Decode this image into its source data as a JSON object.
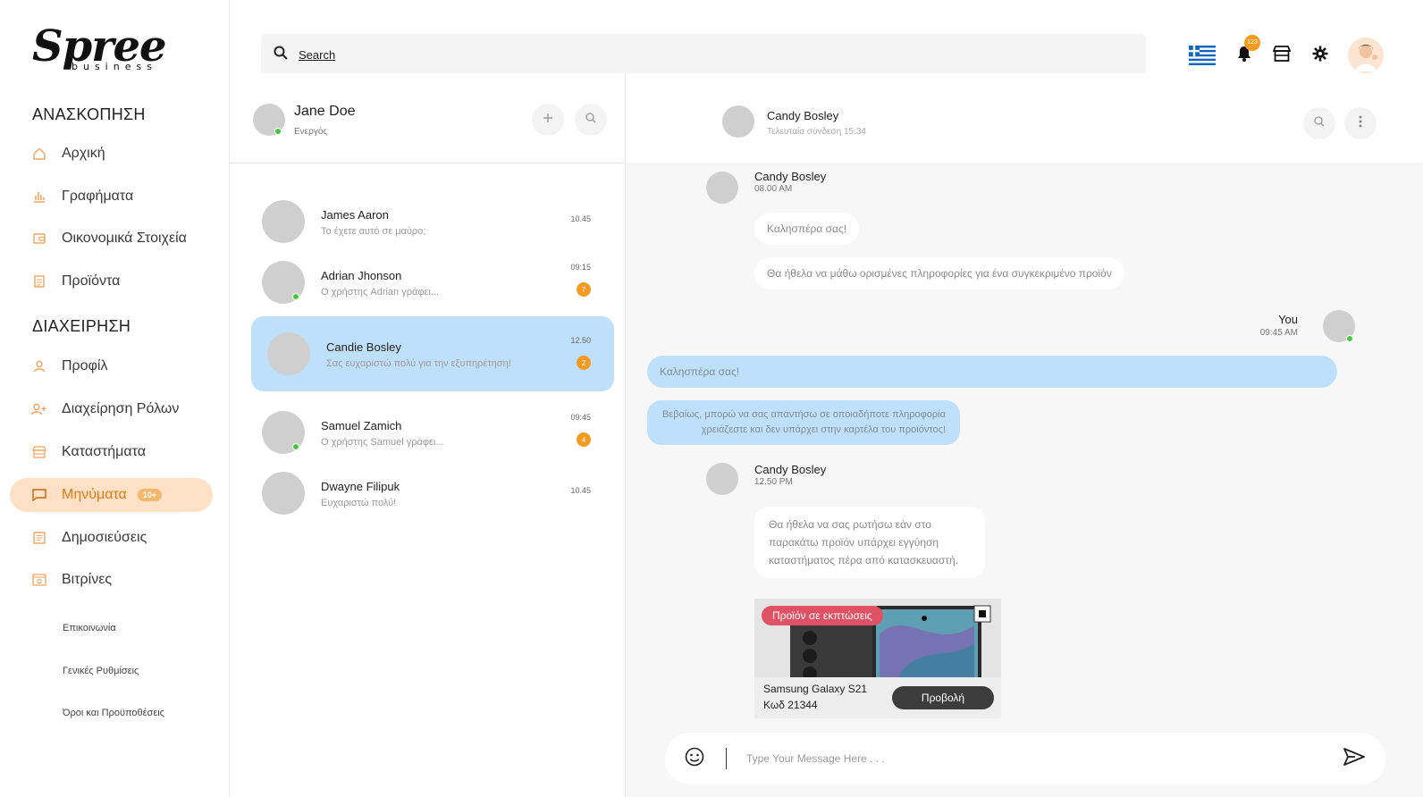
{
  "brand": {
    "name": "Spree",
    "sub": "business"
  },
  "sidebar": {
    "overview_title": "ΑΝΑΣΚΟΠΗΣΗ",
    "overview_items": [
      {
        "label": "Αρχική",
        "icon": "home-icon"
      },
      {
        "label": "Γραφήματα",
        "icon": "bar-chart-icon"
      },
      {
        "label": "Οικονομικά Στοιχεία",
        "icon": "wallet-icon"
      },
      {
        "label": "Προϊόντα",
        "icon": "document-icon"
      }
    ],
    "manage_title": "ΔΙΑΧΕΙΡΗΣΗ",
    "manage_items": [
      {
        "label": "Προφίλ",
        "icon": "user-icon"
      },
      {
        "label": "Διαχείρηση Ρόλων",
        "icon": "user-add-icon"
      },
      {
        "label": "Καταστήματα",
        "icon": "store-icon"
      },
      {
        "label": "Μηνύματα",
        "icon": "chat-icon",
        "badge": "10+"
      },
      {
        "label": "Δημοσιεύσεις",
        "icon": "post-icon"
      },
      {
        "label": "Βιτρίνες",
        "icon": "showcase-icon"
      }
    ],
    "sub_items": [
      "Επικοινωνία",
      "Γενικές Ρυθμίσεις",
      "Όροι και Προϋποθέσεις"
    ]
  },
  "search": {
    "placeholder": "Search"
  },
  "topbar": {
    "notification_count": "123"
  },
  "profile": {
    "name": "Jane Doe",
    "status": "Ενεργός"
  },
  "conversations": [
    {
      "name": "James Aaron",
      "preview": "Το έχετε αυτό σε μαύρο;",
      "time": "10.45",
      "count": ""
    },
    {
      "name": "Adrian Jhonson",
      "preview": "Ο χρήστης Adrian γράφει...",
      "time": "09:15",
      "count": "7"
    },
    {
      "name": "Candie Bosley",
      "preview": "Σας ευχαριστώ πολύ για την εξυπηρέτηση!",
      "time": "12.50",
      "count": "2"
    },
    {
      "name": "Samuel Zamich",
      "preview": "Ο χρήστης Samuel γράφει...",
      "time": "09:45",
      "count": "4"
    },
    {
      "name": "Dwayne Filipuk",
      "preview": "Ευχαριστώ πολύ!",
      "time": "10.45",
      "count": ""
    }
  ],
  "chat": {
    "contact_name": "Candy Bosley",
    "last_seen": "Τελευταία σύνδεση 15:34",
    "group1": {
      "name": "Candy Bosley",
      "time": "08.00 AM",
      "messages": [
        "Καλησπέρα σας!",
        "Θα ήθελα να μάθω ορισμένες πληροφορίες για ένα συγκεκριμένο προϊόν"
      ]
    },
    "group2": {
      "name": "You",
      "time": "09:45 AM",
      "messages": [
        "Καλησπέρα σας!",
        "Βεβαίως, μπορώ να σας απαντήσω σε οποιαδήποτε πληροφορία χρειάζεστε και δεν υπάρχει στην καρτέλα του προϊόντος!"
      ]
    },
    "group3": {
      "name": "Candy Bosley",
      "time": "12.50 PM",
      "message": "Θα ήθελα να σας ρωτήσω εάν στο παρακάτω προϊόν υπάρχει εγγύηση καταστήματος πέρα από κατασκευαστή."
    },
    "product": {
      "tag": "Προϊόν σε εκπτώσεις",
      "name": "Samsung Galaxy S21",
      "code": "Κωδ 21344",
      "button": "Προβολή"
    },
    "composer_placeholder": "Type Your Message Here . . ."
  },
  "colors": {
    "accent": "#f39a21",
    "active_nav_bg": "#fde0c6",
    "selected_chat": "#bfe0fa",
    "sale_tag": "#e05263"
  }
}
